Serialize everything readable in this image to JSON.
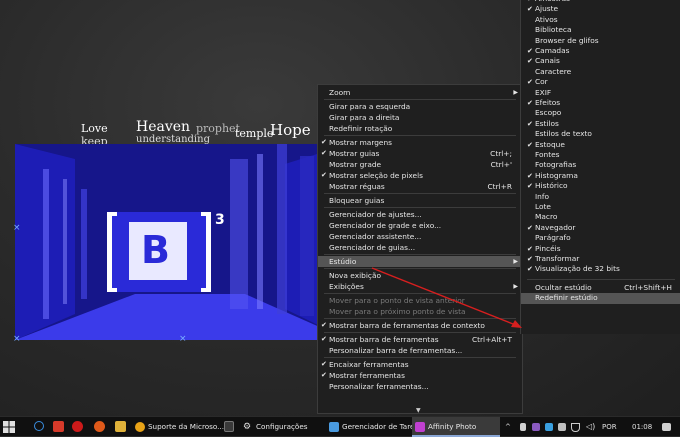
{
  "canvas": {
    "words": [
      "Love",
      "keep",
      "Heaven",
      "understanding",
      "prophet",
      "temple",
      "Hope"
    ],
    "photo_sign": "B",
    "photo_superscript": "3"
  },
  "context_menu": {
    "items": [
      {
        "label": "Zoom",
        "checked": false,
        "submenu": true
      },
      {
        "sep": true
      },
      {
        "label": "Girar para a esquerda",
        "checked": false
      },
      {
        "label": "Girar para a direita",
        "checked": false
      },
      {
        "label": "Redefinir rotação",
        "checked": false
      },
      {
        "sep": true
      },
      {
        "label": "Mostrar margens",
        "checked": true
      },
      {
        "label": "Mostrar guias",
        "checked": true,
        "shortcut": "Ctrl+;"
      },
      {
        "label": "Mostrar grade",
        "checked": false,
        "shortcut": "Ctrl+'"
      },
      {
        "label": "Mostrar seleção de pixels",
        "checked": true
      },
      {
        "label": "Mostrar réguas",
        "checked": false,
        "shortcut": "Ctrl+R"
      },
      {
        "sep": true
      },
      {
        "label": "Bloquear guias",
        "checked": false
      },
      {
        "sep": true
      },
      {
        "label": "Gerenciador de ajustes...",
        "checked": false
      },
      {
        "label": "Gerenciador de grade e eixo...",
        "checked": false
      },
      {
        "label": "Gerenciador assistente...",
        "checked": false
      },
      {
        "label": "Gerenciador de guias...",
        "checked": false
      },
      {
        "sep": true
      },
      {
        "label": "Estúdio",
        "checked": false,
        "submenu": true,
        "highlight": true
      },
      {
        "sep": true
      },
      {
        "label": "Nova exibição",
        "checked": false
      },
      {
        "label": "Exibições",
        "checked": false,
        "submenu": true
      },
      {
        "sep": true
      },
      {
        "label": "Mover para o ponto de vista anterior",
        "checked": false,
        "disabled": true
      },
      {
        "label": "Mover para o próximo ponto de vista",
        "checked": false,
        "disabled": true
      },
      {
        "sep": true
      },
      {
        "label": "Mostrar barra de ferramentas de contexto",
        "checked": true
      },
      {
        "sep": true
      },
      {
        "label": "Mostrar barra de ferramentas",
        "checked": true,
        "shortcut": "Ctrl+Alt+T"
      },
      {
        "label": "Personalizar barra de ferramentas...",
        "checked": false
      },
      {
        "sep": true
      },
      {
        "label": "Encaixar ferramentas",
        "checked": true
      },
      {
        "label": "Mostrar ferramentas",
        "checked": true
      },
      {
        "label": "Personalizar ferramentas...",
        "checked": false
      }
    ]
  },
  "studio_menu": {
    "items": [
      {
        "label": "Amostras",
        "checked": true
      },
      {
        "label": "Ajuste",
        "checked": true
      },
      {
        "label": "Ativos",
        "checked": false
      },
      {
        "label": "Biblioteca",
        "checked": false
      },
      {
        "label": "Browser de glifos",
        "checked": false
      },
      {
        "label": "Camadas",
        "checked": true
      },
      {
        "label": "Canais",
        "checked": true
      },
      {
        "label": "Caractere",
        "checked": false
      },
      {
        "label": "Cor",
        "checked": true
      },
      {
        "label": "EXIF",
        "checked": false
      },
      {
        "label": "Efeitos",
        "checked": true
      },
      {
        "label": "Escopo",
        "checked": false
      },
      {
        "label": "Estilos",
        "checked": true
      },
      {
        "label": "Estilos de texto",
        "checked": false
      },
      {
        "label": "Estoque",
        "checked": true
      },
      {
        "label": "Fontes",
        "checked": false
      },
      {
        "label": "Fotografias",
        "checked": false
      },
      {
        "label": "Histograma",
        "checked": true
      },
      {
        "label": "Histórico",
        "checked": true
      },
      {
        "label": "Info",
        "checked": false
      },
      {
        "label": "Lote",
        "checked": false
      },
      {
        "label": "Macro",
        "checked": false
      },
      {
        "label": "Navegador",
        "checked": true
      },
      {
        "label": "Parágrafo",
        "checked": false
      },
      {
        "label": "Pincéis",
        "checked": true
      },
      {
        "label": "Transformar",
        "checked": true
      },
      {
        "label": "Visualização de 32 bits",
        "checked": true
      },
      {
        "sep": true
      },
      {
        "label": "Ocultar estúdio",
        "checked": false,
        "shortcut": "Ctrl+Shift+H"
      },
      {
        "label": "Redefinir estúdio",
        "checked": false,
        "highlight": true
      }
    ]
  },
  "taskbar": {
    "apps": [
      {
        "label": "Suporte da Microso...",
        "icon": "chrome-icon",
        "color": "#e8a317"
      },
      {
        "label": "Configurações",
        "icon": "gear-icon",
        "color": "#cfcfcf"
      },
      {
        "label": "Gerenciador de Tare...",
        "icon": "task-manager-icon",
        "color": "#4a9be0"
      },
      {
        "label": "Affinity Photo",
        "icon": "affinity-photo-icon",
        "color": "#c040d0",
        "active": true
      }
    ],
    "tray": {
      "language": "POR",
      "time": "01:08"
    }
  },
  "colors": {
    "menu_bg": "#1f1f1f",
    "highlight": "#555555",
    "annotation_arrow": "#d61f1f",
    "photo_blue": "#2b2bd0"
  }
}
